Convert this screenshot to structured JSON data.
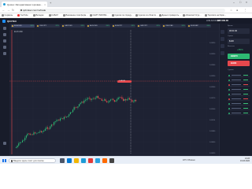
{
  "browser": {
    "tab_title": "Quotex: Интерактивная торговая…",
    "url": "qxbroker.com/ru/trade",
    "bookmarks": [
      "Сервисы",
      "YouTube",
      "Вкладки",
      "КАБАЛ",
      "Вниманию платформ…",
      "СНИТ ЛЕБ ВЫ…",
      "Сделки по спреду…",
      "Сделки из области…",
      "Деньги проверить…",
      "Advanced Cryp…",
      "Торговля на бирж…"
    ]
  },
  "app": {
    "brand": "QUOTEX",
    "account_label": "LIVE ACCOUNT",
    "balance": "$10 000.00",
    "asset_tabs": [
      {
        "label": "EUR/USD",
        "pct": "85%"
      },
      {
        "label": "USD/JPY",
        "pct": "82%"
      },
      {
        "label": "GBP/USD",
        "pct": "85%"
      },
      {
        "label": "AUD/USD",
        "pct": "80%"
      },
      {
        "label": "EUR/JPY",
        "pct": "85%"
      },
      {
        "label": "GBP/JPY",
        "pct": "82%"
      },
      {
        "label": "USD/CAD",
        "pct": "85%"
      },
      {
        "label": "EUR/GBP",
        "pct": "80%"
      },
      {
        "label": "USD/CHF",
        "pct": "85%"
      }
    ],
    "chart_legend": "EUR/USD",
    "price_tag": "1.08245",
    "price_labels": [
      "1.08320",
      "1.08290",
      "1.08260",
      "1.08230",
      "1.08200",
      "1.08170",
      "1.08140",
      "1.08110",
      "1.08080",
      "1.08050",
      "1.08020"
    ],
    "panel": {
      "time_label": "Время",
      "time_value": "00:01:00",
      "amount_label": "Сумма",
      "amount_value": "$100",
      "payout_label": "Выплата",
      "payout_value": "+85%",
      "up_label": "ВВЕРХ",
      "down_label": "ВНИЗ",
      "trades_label": "Сделки"
    }
  },
  "taskbar": {
    "search_placeholder": "Введите здесь текст для поиска",
    "weather": "18°C Облачно",
    "time": "13:23",
    "date": "19.03.2022"
  },
  "colors": {
    "bull": "#2eb873",
    "bear": "#e5484d",
    "accent": "#1e90ff"
  }
}
